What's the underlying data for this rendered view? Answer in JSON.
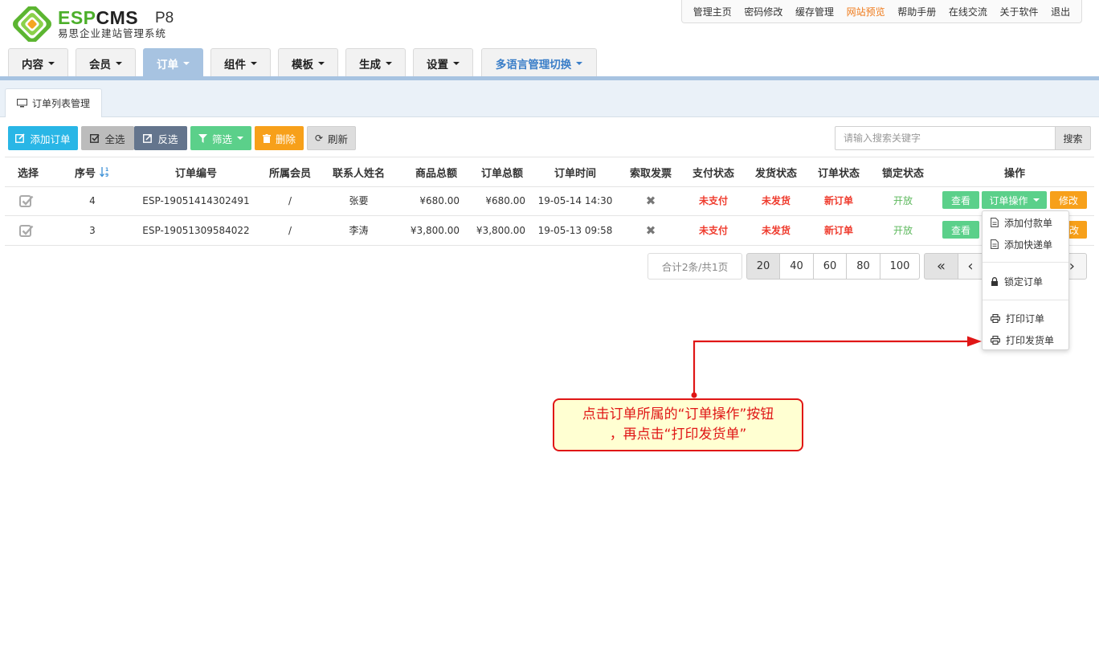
{
  "brand": {
    "name_part1": "ESP",
    "name_part2": "CMS",
    "version": "P8",
    "subtitle": "易思企业建站管理系统"
  },
  "top_links": [
    "管理主页",
    "密码修改",
    "缓存管理",
    "网站预览",
    "帮助手册",
    "在线交流",
    "关于软件",
    "退出"
  ],
  "top_links_highlight": "网站预览",
  "nav": {
    "items": [
      "内容",
      "会员",
      "订单",
      "组件",
      "模板",
      "生成",
      "设置",
      "多语言管理切换"
    ],
    "active": "订单"
  },
  "sub_tab": "订单列表管理",
  "toolbar": {
    "add_order": "添加订单",
    "select_all": "全选",
    "invert": "反选",
    "filter": "筛选",
    "delete": "删除",
    "refresh": "刷新",
    "search_placeholder": "请输入搜索关键字",
    "search_btn": "搜索"
  },
  "colors": {
    "add": "#29b6e6",
    "select_all": "#bcbcbc",
    "invert": "#64758d",
    "filter": "#5bd08a",
    "delete": "#f7a01a",
    "refresh": "#dddddd",
    "view": "#5bd08a",
    "orderop": "#5bd08a",
    "edit": "#f7a01a",
    "red": "#ef3b2d",
    "green": "#5cb85c"
  },
  "table": {
    "headers": [
      "选择",
      "序号",
      "订单编号",
      "所属会员",
      "联系人姓名",
      "商品总额",
      "订单总额",
      "订单时间",
      "索取发票",
      "支付状态",
      "发货状态",
      "订单状态",
      "锁定状态",
      "操作"
    ],
    "rows": [
      {
        "seq": "4",
        "order_no": "ESP-19051414302491",
        "member": "/",
        "contact": "张要",
        "goods_total": "¥680.00",
        "order_total": "¥680.00",
        "time": "19-05-14 14:30",
        "pay": "未支付",
        "ship": "未发货",
        "status": "新订单",
        "lock": "开放"
      },
      {
        "seq": "3",
        "order_no": "ESP-19051309584022",
        "member": "/",
        "contact": "李涛",
        "goods_total": "¥3,800.00",
        "order_total": "¥3,800.00",
        "time": "19-05-13 09:58",
        "pay": "未支付",
        "ship": "未发货",
        "status": "新订单",
        "lock": "开放"
      }
    ],
    "row_actions": {
      "view": "查看",
      "order_op": "订单操作",
      "edit": "修改",
      "edit_partial": "改"
    }
  },
  "pagination": {
    "summary": "合计2条/共1页",
    "sizes": [
      "20",
      "40",
      "60",
      "80",
      "100"
    ],
    "active": "20",
    "first": "«",
    "prev": "‹",
    "next": "›"
  },
  "dropdown": [
    "添加付款单",
    "添加快递单",
    "锁定订单",
    "打印订单",
    "打印发货单"
  ],
  "callout": {
    "line1": "点击订单所属的“订单操作”按钮",
    "line2": "，再点击“打印发货单”"
  }
}
